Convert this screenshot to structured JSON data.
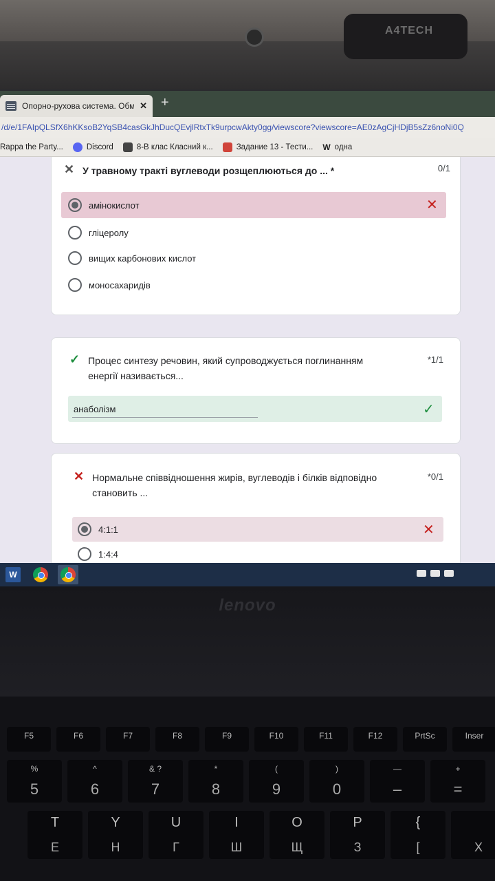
{
  "hardware": {
    "webcam_brand": "A4TECH",
    "laptop_brand": "lenovo"
  },
  "browser": {
    "tab_title": "Опорно-рухова система. Обмін",
    "tab_close": "✕",
    "new_tab": "+",
    "url": "/d/e/1FAIpQLSfX6hKKsoB2YqSB4casGkJhDucQEvjlRtxTk9urpcwAkty0gg/viewscore?viewscore=AE0zAgCjHDjB5sZz6noNi0Q",
    "bookmarks": [
      {
        "label": "Rappa the Party...",
        "icon": "none"
      },
      {
        "label": "Discord",
        "icon": "discord-icon"
      },
      {
        "label": "8-В клас Класний к...",
        "icon": "class-icon"
      },
      {
        "label": "Задание 13 - Тести...",
        "icon": "zadanie-icon"
      },
      {
        "label": "одна",
        "icon": "w-icon",
        "icon_text": "W"
      }
    ]
  },
  "form": {
    "q1": {
      "status": "wrong",
      "mark": "✕",
      "title": "У травному тракті вуглеводи розщеплюються до ... *",
      "score": "0/1",
      "options": [
        {
          "label": "амінокислот",
          "selected": true,
          "wrong": true
        },
        {
          "label": "гліцеролу",
          "selected": false
        },
        {
          "label": "вищих карбонових кислот",
          "selected": false
        },
        {
          "label": "моносахаридів",
          "selected": false
        }
      ],
      "wrong_icon": "✕"
    },
    "q2": {
      "status": "correct",
      "mark": "✓",
      "title_line1": "Процес синтезу речовин, який супроводжується поглинанням",
      "title_line2": "енергії називається...",
      "score": "*1/1",
      "answer": "анаболізм",
      "correct_icon": "✓"
    },
    "q3": {
      "status": "wrong",
      "mark": "✕",
      "title_line1": "Нормальне співвідношення жирів, вуглеводів і білків відповідно",
      "title_line2": "становить ...",
      "score": "*0/1",
      "options": [
        {
          "label": "4:1:1",
          "selected": true,
          "wrong": true
        },
        {
          "label": "1:4:4",
          "selected": false
        }
      ],
      "wrong_icon": "✕"
    }
  },
  "taskbar": {
    "word_label": "W"
  },
  "keyboard": {
    "fkeys": [
      "F5",
      "F6",
      "F7",
      "F8",
      "F9",
      "F10",
      "F11",
      "F12",
      "PrtSc",
      "Inser"
    ],
    "num_row": [
      {
        "top": "%",
        "big": "5"
      },
      {
        "top": "^",
        "big": "6"
      },
      {
        "top": "& ?",
        "big": "7"
      },
      {
        "top": "*",
        "big": "8"
      },
      {
        "top": "(",
        "big": "9"
      },
      {
        "top": ")",
        "big": "0"
      },
      {
        "top": "—",
        "big": "–"
      },
      {
        "top": "+",
        "big": "="
      }
    ],
    "letter_row": [
      {
        "top": "T",
        "big": "Е"
      },
      {
        "top": "Y",
        "big": "Н"
      },
      {
        "top": "U",
        "big": "Г"
      },
      {
        "top": "I",
        "big": "Ш"
      },
      {
        "top": "O",
        "big": "Щ"
      },
      {
        "top": "P",
        "big": "З"
      },
      {
        "top": "{",
        "big": "["
      },
      {
        "top": "",
        "big": "Х"
      }
    ]
  },
  "colors": {
    "wrong_bg": "#e8c9d4",
    "correct_bg": "#dfefe6",
    "taskbar": "#1d2e47",
    "url_blue": "#3a52b0"
  }
}
